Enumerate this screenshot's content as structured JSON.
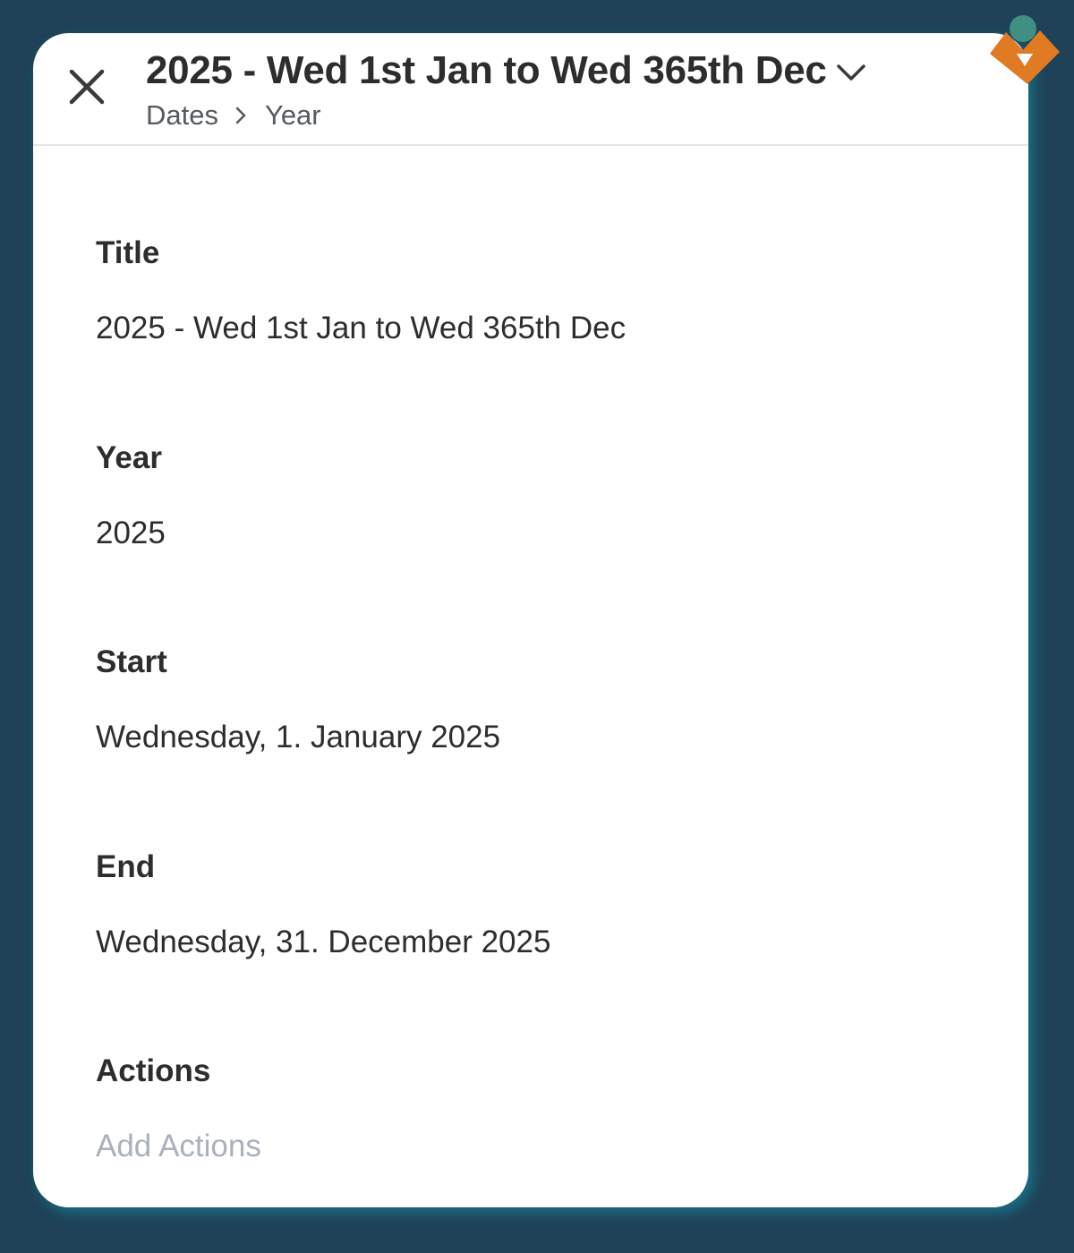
{
  "header": {
    "title": "2025 - Wed 1st Jan to Wed 365th Dec",
    "breadcrumb": [
      "Dates",
      "Year"
    ]
  },
  "fields": {
    "title": {
      "label": "Title",
      "value": "2025 - Wed 1st Jan to Wed 365th Dec"
    },
    "year": {
      "label": "Year",
      "value": "2025"
    },
    "start": {
      "label": "Start",
      "value": "Wednesday, 1. January 2025"
    },
    "end": {
      "label": "End",
      "value": "Wednesday, 31. December 2025"
    },
    "actions": {
      "label": "Actions",
      "placeholder": "Add Actions"
    }
  },
  "icons": {
    "close": "close-icon",
    "dropdown": "chevron-down-icon",
    "breadcrumb_separator": "chevron-right-icon",
    "logo": "app-logo-icon"
  },
  "colors": {
    "background": "#1f4258",
    "panel": "#ffffff",
    "text": "#2d2d2d",
    "placeholder": "#a9b1bc",
    "logo_orange": "#e07b24",
    "logo_teal": "#3f8f82"
  }
}
